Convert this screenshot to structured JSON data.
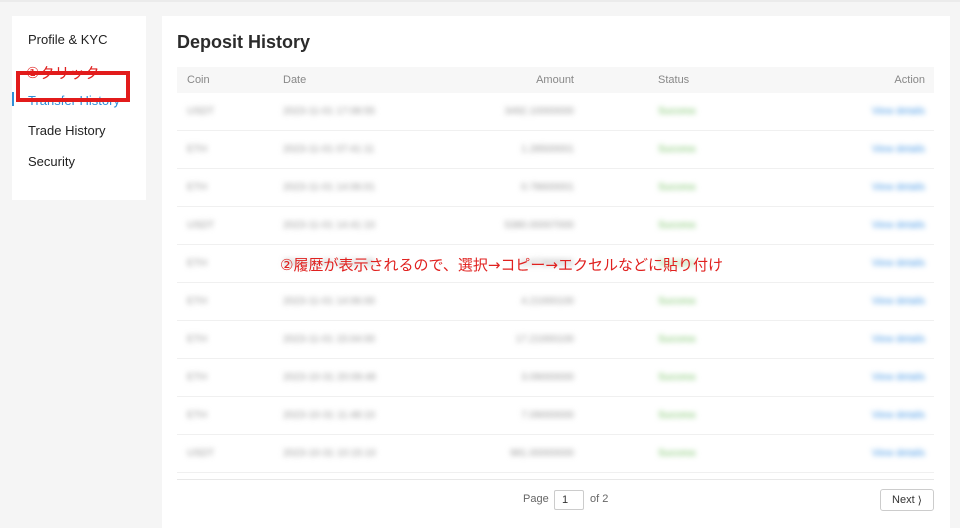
{
  "sidebar": {
    "items": [
      {
        "label": "Profile & KYC",
        "active": false
      },
      {
        "label": "Transfer History",
        "active": true
      },
      {
        "label": "Trade History",
        "active": false
      },
      {
        "label": "Security",
        "active": false
      }
    ]
  },
  "annotations": {
    "step1": "①クリック",
    "step2": "②履歴が表示されるので、選択→コピー→エクセルなどに貼り付け"
  },
  "main": {
    "title": "Deposit History",
    "columns": {
      "coin": "Coin",
      "date": "Date",
      "amount": "Amount",
      "status": "Status",
      "action": "Action"
    },
    "rows": [
      {
        "coin": "USDT",
        "date": "2023-11-01 17:08:55",
        "amount": "3492.10000000",
        "status": "Success",
        "action": "View details"
      },
      {
        "coin": "ETH",
        "date": "2023-11-01 07:41:11",
        "amount": "1.28500001",
        "status": "Success",
        "action": "View details"
      },
      {
        "coin": "ETH",
        "date": "2023-11-01 14:06:01",
        "amount": "0.78600001",
        "status": "Success",
        "action": "View details"
      },
      {
        "coin": "USDT",
        "date": "2023-11-01 14:41:10",
        "amount": "5380.00007000",
        "status": "Success",
        "action": "View details"
      },
      {
        "coin": "ETH",
        "date": "2023-11-01 10:11:25",
        "amount": "0.07300001",
        "status": "Success",
        "action": "View details"
      },
      {
        "coin": "ETH",
        "date": "2023-11-01 14:06:00",
        "amount": "4.21000100",
        "status": "Success",
        "action": "View details"
      },
      {
        "coin": "ETH",
        "date": "2023-11-01 15:04:00",
        "amount": "17.21000100",
        "status": "Success",
        "action": "View details"
      },
      {
        "coin": "ETH",
        "date": "2023-10-31 20:09:48",
        "amount": "3.09000000",
        "status": "Success",
        "action": "View details"
      },
      {
        "coin": "ETH",
        "date": "2023-10-31 11:48:10",
        "amount": "7.09000000",
        "status": "Success",
        "action": "View details"
      },
      {
        "coin": "USDT",
        "date": "2023-10-31 10:15:10",
        "amount": "981.00000000",
        "status": "Success",
        "action": "View details"
      }
    ]
  },
  "pagination": {
    "page_label": "Page",
    "current_page": "1",
    "of_label": "of 2",
    "next_label": "Next",
    "next_icon": "chevron-right-icon"
  },
  "colors": {
    "accent": "#2f8fd8",
    "annotation_red": "#e21b1b",
    "success_green": "#7cc46a",
    "link_blue": "#4a9ae6"
  }
}
